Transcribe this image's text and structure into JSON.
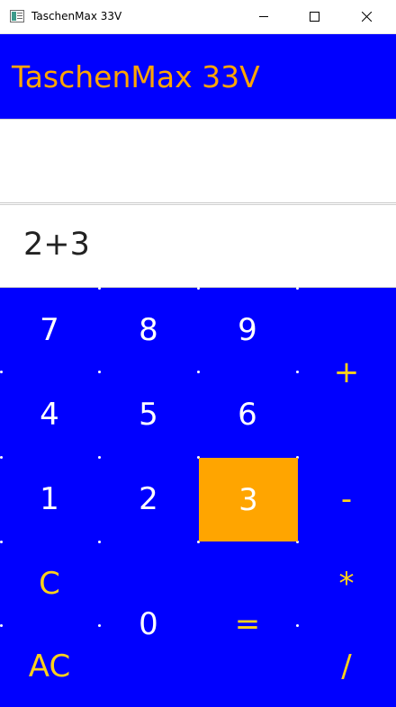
{
  "window": {
    "title": "TaschenMax 33V"
  },
  "header": {
    "title": "TaschenMax 33V"
  },
  "display": {
    "result": "",
    "expression": "2+3"
  },
  "keypad": {
    "k7": "7",
    "k8": "8",
    "k9": "9",
    "k4": "4",
    "k5": "5",
    "k6": "6",
    "k1": "1",
    "k2": "2",
    "k3": "3",
    "k0": "0",
    "plus": "+",
    "minus": "-",
    "multiply": "*",
    "divide": "/",
    "equals": "=",
    "clear": "C",
    "all_clear": "AC",
    "active_key": "3"
  },
  "colors": {
    "background_blue": "#0000ff",
    "title_orange": "#ffa500",
    "operator_yellow": "#ffd21a",
    "active_key_orange": "#ffa500"
  },
  "icons": [
    "app-icon",
    "minimize-icon",
    "maximize-icon",
    "close-icon"
  ]
}
